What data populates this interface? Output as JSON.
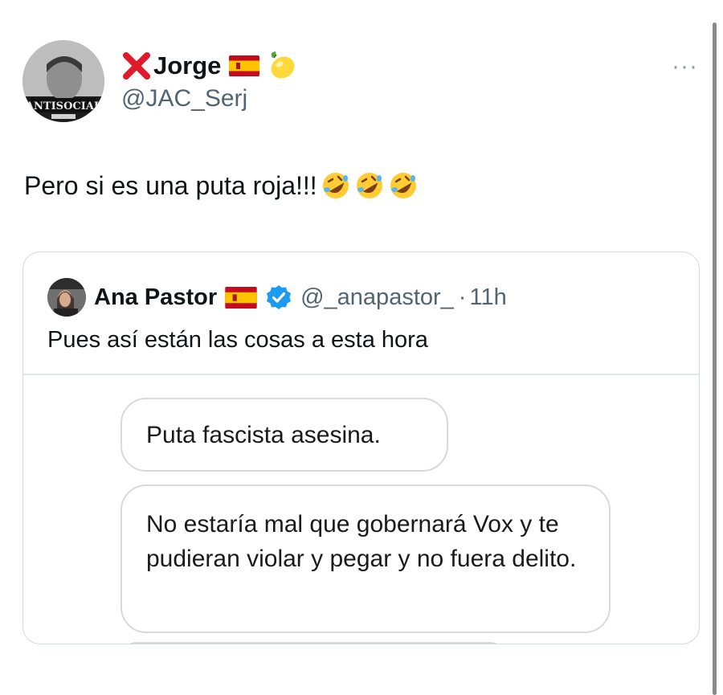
{
  "tweet": {
    "author_name": "Jorge",
    "author_handle": "@JAC_Serj",
    "avatar_text": "ANTISOCIAL",
    "text": "Pero si es una puta roja!!!",
    "more_label": "···"
  },
  "quoted": {
    "author_name": "Ana Pastor",
    "author_handle": "@_anapastor_",
    "separator": "·",
    "time": "11h",
    "text": "Pues así están las cosas a esta hora",
    "messages": [
      "Puta fascista asesina.",
      "No estaría mal que gobernará Vox y te pudieran violar y pegar y no fuera delito."
    ]
  },
  "icons": {
    "x_mark": "cross-mark",
    "flag": "spain-flag",
    "lemon": "lemon",
    "laughing": "rolling-on-floor-laughing",
    "verified": "verified-badge"
  },
  "colors": {
    "x_red": "#e0192b",
    "verified_blue": "#1d9bf0",
    "secondary_text": "#536471",
    "border": "#cfd9de"
  }
}
